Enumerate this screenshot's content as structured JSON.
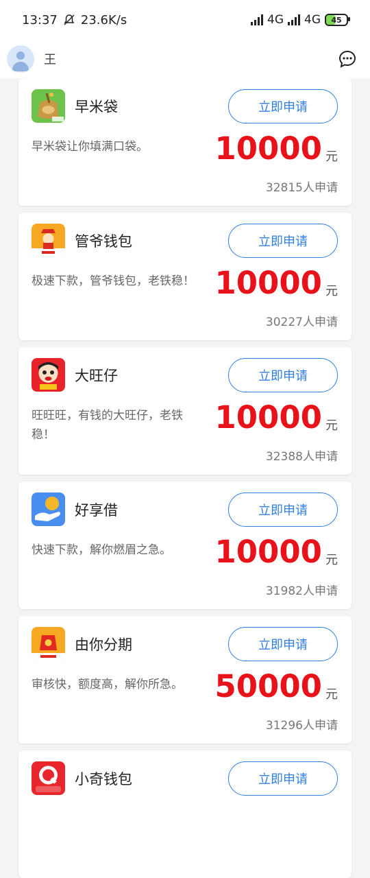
{
  "status_bar": {
    "time": "13:37",
    "net_speed": "23.6K/s",
    "signal1_label": "4G",
    "signal2_label": "4G",
    "battery": "45"
  },
  "header": {
    "username": "王"
  },
  "colors": {
    "accent": "#2f7fe0",
    "amount": "#e8131a"
  },
  "apply_label": "立即申请",
  "unit": "元",
  "items": [
    {
      "name": "早米袋",
      "desc": "早米袋让你填满口袋。",
      "amount": "10000",
      "count": "32815人申请",
      "icon": "rice-bag-logo-icon"
    },
    {
      "name": "管爷钱包",
      "desc": "极速下款，管爷钱包，老铁稳！",
      "amount": "10000",
      "count": "30227人申请",
      "icon": "guanye-wallet-logo-icon"
    },
    {
      "name": "大旺仔",
      "desc": "旺旺旺，有钱的大旺仔，老铁稳！",
      "amount": "10000",
      "count": "32388人申请",
      "icon": "dawangzai-logo-icon"
    },
    {
      "name": "好享借",
      "desc": "快速下款，解你燃眉之急。",
      "amount": "10000",
      "count": "31982人申请",
      "icon": "haoxiangjie-logo-icon"
    },
    {
      "name": "由你分期",
      "desc": "审核快，额度高，解你所急。",
      "amount": "50000",
      "count": "31296人申请",
      "icon": "youni-fenqi-logo-icon"
    },
    {
      "name": "小奇钱包",
      "desc": "",
      "amount": "",
      "count": "",
      "icon": "xiaoqi-wallet-logo-icon"
    }
  ]
}
